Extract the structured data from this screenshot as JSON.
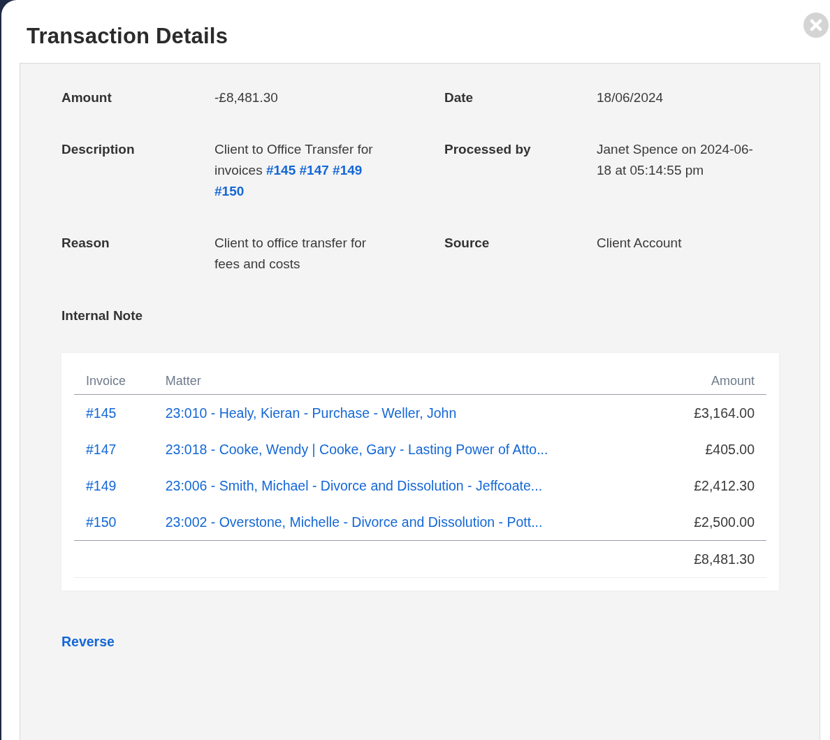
{
  "dialog": {
    "title": "Transaction Details"
  },
  "details": [
    {
      "label": "Amount",
      "value": "-£8,481.30"
    },
    {
      "label": "Date",
      "value": "18/06/2024"
    },
    {
      "label": "Description",
      "value": "Client to Office Transfer for invoices",
      "links": [
        "#145",
        "#147",
        "#149",
        "#150"
      ]
    },
    {
      "label": "Processed by",
      "value": "Janet Spence on 2024-06-18 at 05:14:55 pm"
    },
    {
      "label": "Reason",
      "value": "Client to office transfer for fees and costs"
    },
    {
      "label": "Source",
      "value": "Client Account"
    }
  ],
  "internal_note": {
    "label": "Internal Note"
  },
  "table": {
    "columns": [
      "Invoice",
      "Matter",
      "Amount"
    ],
    "rows": [
      {
        "invoice": "#145",
        "matter": "23:010 - Healy, Kieran - Purchase - Weller, John",
        "amount": "£3,164.00"
      },
      {
        "invoice": "#147",
        "matter": "23:018 - Cooke, Wendy | Cooke, Gary - Lasting Power of Atto...",
        "amount": "£405.00"
      },
      {
        "invoice": "#149",
        "matter": "23:006 - Smith, Michael - Divorce and Dissolution - Jeffcoate...",
        "amount": "£2,412.30"
      },
      {
        "invoice": "#150",
        "matter": "23:002 - Overstone, Michelle - Divorce and Dissolution - Pott...",
        "amount": "£2,500.00"
      }
    ],
    "total": "£8,481.30"
  },
  "actions": {
    "reverse": "Reverse"
  }
}
